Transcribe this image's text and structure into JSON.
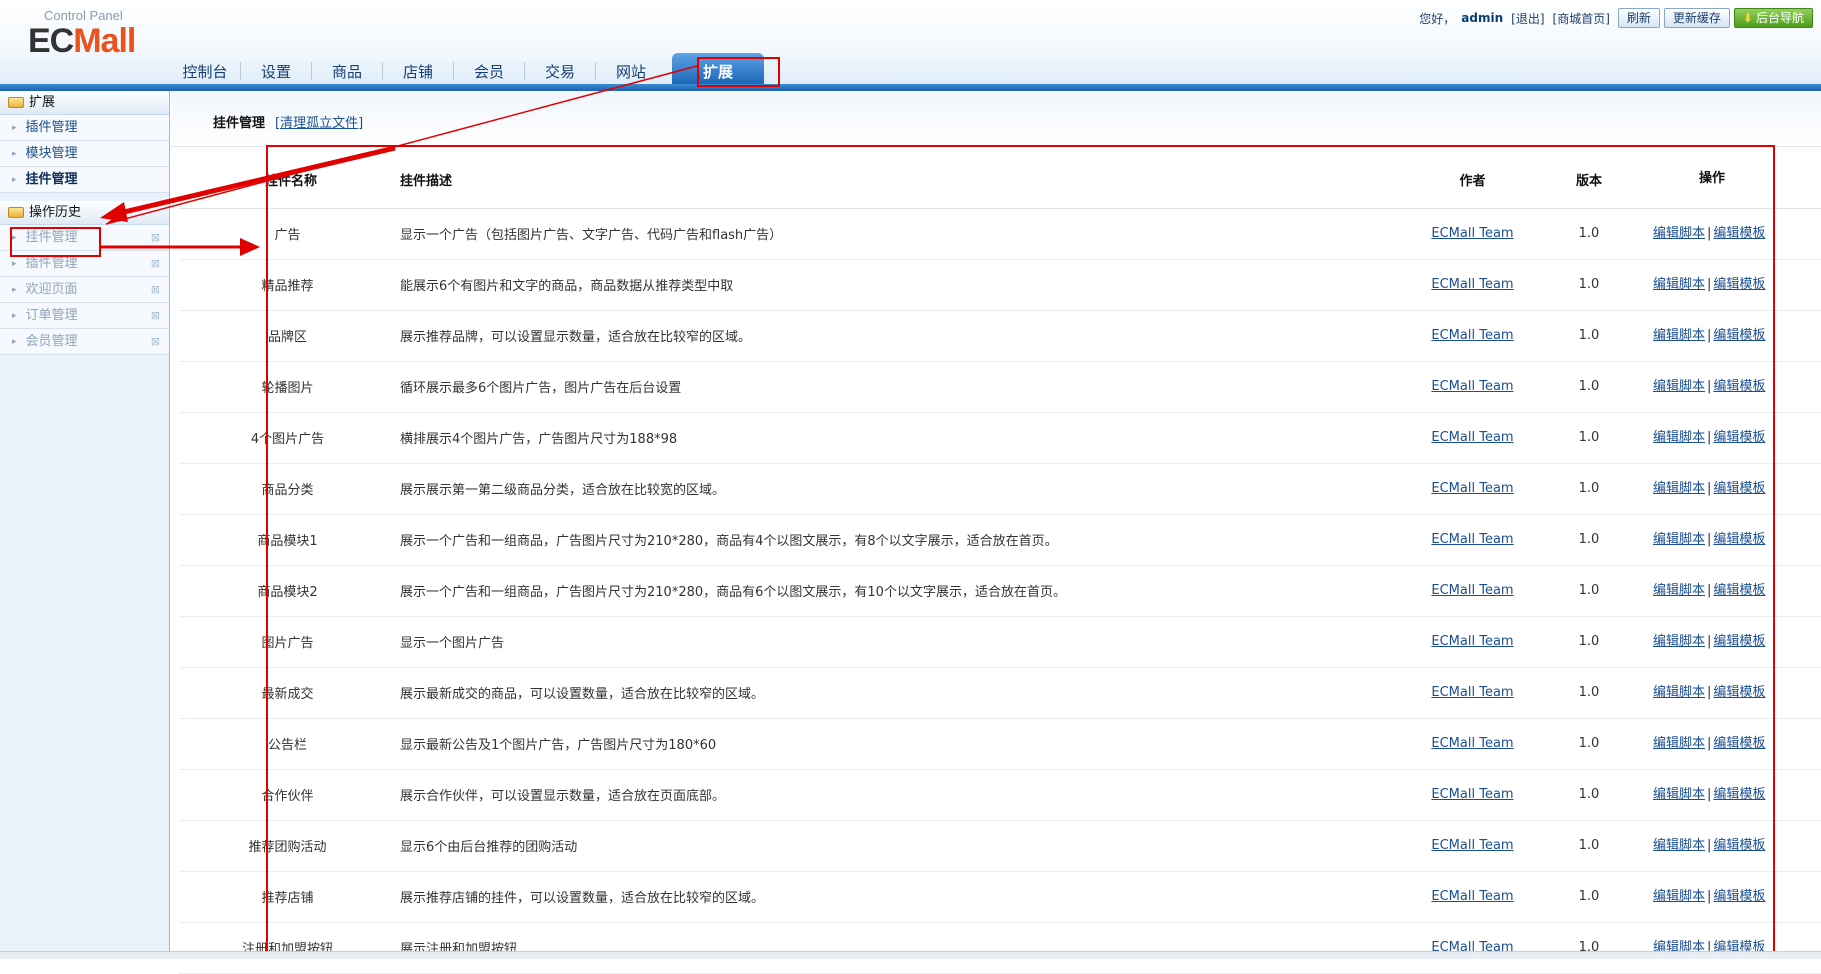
{
  "header": {
    "logo_subtitle": "Control Panel",
    "logo_ec": "EC",
    "logo_mall": "Mall",
    "greeting": "您好，",
    "username": "admin",
    "logout": "[退出]",
    "store_home": "[商城首页]",
    "refresh_btn": "刷新",
    "update_cache_btn": "更新缓存",
    "admin_nav_btn": "后台导航",
    "nav": [
      "控制台",
      "设置",
      "商品",
      "店铺",
      "会员",
      "交易",
      "网站",
      "扩展"
    ],
    "active_nav": "扩展"
  },
  "sidebar": {
    "section1_title": "扩展",
    "section1_items": [
      "插件管理",
      "模块管理",
      "挂件管理"
    ],
    "section2_title": "操作历史",
    "history_items": [
      "挂件管理",
      "插件管理",
      "欢迎页面",
      "订单管理",
      "会员管理"
    ]
  },
  "main": {
    "title": "挂件管理",
    "clean_link": "清理孤立文件",
    "columns": {
      "name": "挂件名称",
      "desc": "挂件描述",
      "author": "作者",
      "version": "版本",
      "op": "操作"
    },
    "rows": [
      {
        "name": "广告",
        "desc": "显示一个广告（包括图片广告、文字广告、代码广告和flash广告）",
        "author": "ECMall Team",
        "version": "1.0"
      },
      {
        "name": "精品推荐",
        "desc": "能展示6个有图片和文字的商品，商品数据从推荐类型中取",
        "author": "ECMall Team",
        "version": "1.0"
      },
      {
        "name": "品牌区",
        "desc": "展示推荐品牌，可以设置显示数量，适合放在比较窄的区域。",
        "author": "ECMall Team",
        "version": "1.0"
      },
      {
        "name": "轮播图片",
        "desc": "循环展示最多6个图片广告，图片广告在后台设置",
        "author": "ECMall Team",
        "version": "1.0"
      },
      {
        "name": "4个图片广告",
        "desc": "横排展示4个图片广告，广告图片尺寸为188*98",
        "author": "ECMall Team",
        "version": "1.0"
      },
      {
        "name": "商品分类",
        "desc": "展示展示第一第二级商品分类，适合放在比较宽的区域。",
        "author": "ECMall Team",
        "version": "1.0"
      },
      {
        "name": "商品模块1",
        "desc": "展示一个广告和一组商品，广告图片尺寸为210*280，商品有4个以图文展示，有8个以文字展示，适合放在首页。",
        "author": "ECMall Team",
        "version": "1.0"
      },
      {
        "name": "商品模块2",
        "desc": "展示一个广告和一组商品，广告图片尺寸为210*280，商品有6个以图文展示，有10个以文字展示，适合放在首页。",
        "author": "ECMall Team",
        "version": "1.0"
      },
      {
        "name": "图片广告",
        "desc": "显示一个图片广告",
        "author": "ECMall Team",
        "version": "1.0"
      },
      {
        "name": "最新成交",
        "desc": "展示最新成交的商品，可以设置数量，适合放在比较窄的区域。",
        "author": "ECMall Team",
        "version": "1.0"
      },
      {
        "name": "公告栏",
        "desc": "显示最新公告及1个图片广告，广告图片尺寸为180*60",
        "author": "ECMall Team",
        "version": "1.0"
      },
      {
        "name": "合作伙伴",
        "desc": "展示合作伙伴，可以设置显示数量，适合放在页面底部。",
        "author": "ECMall Team",
        "version": "1.0"
      },
      {
        "name": "推荐团购活动",
        "desc": "显示6个由后台推荐的团购活动",
        "author": "ECMall Team",
        "version": "1.0"
      },
      {
        "name": "推荐店铺",
        "desc": "展示推荐店铺的挂件，可以设置数量，适合放在比较窄的区域。",
        "author": "ECMall Team",
        "version": "1.0"
      },
      {
        "name": "注册和加盟按钮",
        "desc": "展示注册和加盟按钮",
        "author": "ECMall Team",
        "version": "1.0"
      }
    ],
    "op_edit_script": "编辑脚本",
    "op_pipe": "|",
    "op_edit_template": "编辑模板"
  },
  "colors": {
    "annotation_red": "#e00000",
    "nav_active": "#1b67b8",
    "link": "#1a4f93",
    "logo_accent": "#e8541c"
  }
}
